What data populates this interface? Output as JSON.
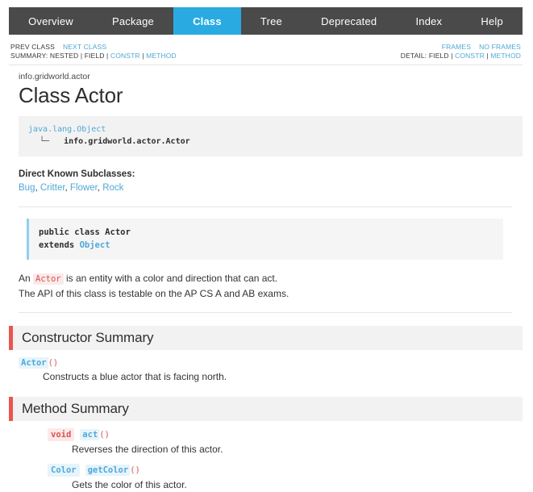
{
  "topnav": {
    "items": [
      {
        "label": "Overview",
        "active": false
      },
      {
        "label": "Package",
        "active": false
      },
      {
        "label": "Class",
        "active": true
      },
      {
        "label": "Tree",
        "active": false
      },
      {
        "label": "Deprecated",
        "active": false
      },
      {
        "label": "Index",
        "active": false
      },
      {
        "label": "Help",
        "active": false
      }
    ],
    "active_color": "#29abe2",
    "bar_color": "#4a4a4a"
  },
  "subnav": {
    "prev_class": "PREV CLASS",
    "next_class": "NEXT CLASS",
    "frames": "FRAMES",
    "no_frames": "NO FRAMES",
    "summary_label": "SUMMARY:",
    "summary_nested": "NESTED",
    "summary_field": "FIELD",
    "summary_constr": "CONSTR",
    "summary_method": "METHOD",
    "detail_label": "DETAIL:",
    "detail_field": "FIELD",
    "detail_constr": "CONSTR",
    "detail_method": "METHOD",
    "separator": "|"
  },
  "header": {
    "package": "info.gridworld.actor",
    "title": "Class Actor"
  },
  "inheritance": {
    "root": "java.lang.Object",
    "glyph": "└─",
    "child": "info.gridworld.actor.Actor"
  },
  "subclasses": {
    "label": "Direct Known Subclasses:",
    "items": [
      "Bug",
      "Critter",
      "Flower",
      "Rock"
    ],
    "separator": ", "
  },
  "declaration": {
    "line1": "public class Actor",
    "extends_keyword": "extends",
    "extends_type": "Object"
  },
  "description": {
    "before_code": "An ",
    "code": "Actor",
    "after_code": " is an entity with a color and direction that can act.",
    "line2": "The API of this class is testable on the AP CS A and AB exams."
  },
  "constructor_summary": {
    "title": "Constructor Summary",
    "entries": [
      {
        "name": "Actor",
        "parens": "()",
        "description": "Constructs a blue actor that is facing north."
      }
    ]
  },
  "method_summary": {
    "title": "Method Summary",
    "entries": [
      {
        "return_type": "void",
        "return_kind": "void",
        "name": "act",
        "parens": "()",
        "description": "Reverses the direction of this actor."
      },
      {
        "return_type": "Color",
        "return_kind": "type",
        "name": "getColor",
        "parens": "()",
        "description": "Gets the color of this actor."
      }
    ]
  },
  "colors": {
    "accent_red": "#e8564f",
    "link_blue": "#4fa8d8",
    "active_tab": "#29abe2",
    "nav_dark": "#4a4a4a",
    "code_bg": "#f2f2f2"
  }
}
